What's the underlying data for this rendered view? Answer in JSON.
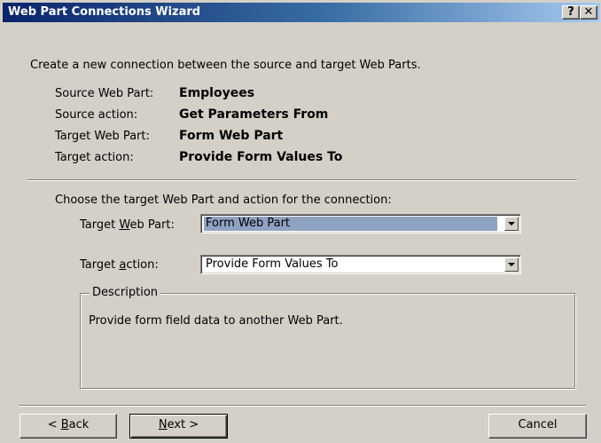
{
  "window": {
    "title": "Web Part Connections Wizard",
    "help_button": "?",
    "close_button": "✕"
  },
  "intro": "Create a new connection between the source and target Web Parts.",
  "summary": [
    {
      "label": "Source Web Part:",
      "value": "Employees"
    },
    {
      "label": "Source action:",
      "value": "Get Parameters From"
    },
    {
      "label": "Target Web Part:",
      "value": "Form Web Part"
    },
    {
      "label": "Target action:",
      "value": "Provide Form Values To"
    }
  ],
  "choose_prompt": "Choose the target Web Part and action for the connection:",
  "target_web_part": {
    "label_pre": "Target ",
    "label_mnemonic": "W",
    "label_post": "eb Part:",
    "value": "Form Web Part"
  },
  "target_action": {
    "label_pre": "Target ",
    "label_mnemonic": "a",
    "label_post": "ction:",
    "value": "Provide Form Values To"
  },
  "description": {
    "legend": "Description",
    "text": "Provide form field data to another Web Part."
  },
  "buttons": {
    "back_pre": "< ",
    "back_mnemonic": "B",
    "back_post": "ack",
    "next_mnemonic": "N",
    "next_post": "ext >",
    "cancel": "Cancel"
  }
}
